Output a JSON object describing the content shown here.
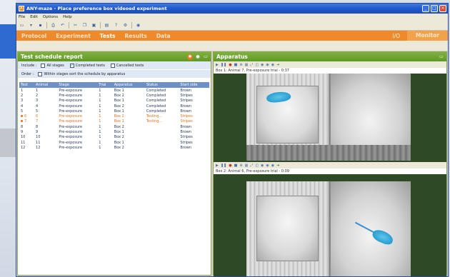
{
  "window": {
    "title": "ANY-maze - Place preference box videoed experiment",
    "app_icon_letter": "A"
  },
  "menu": [
    "File",
    "Edit",
    "Options",
    "Help"
  ],
  "nav": {
    "items": [
      {
        "label": "Protocol",
        "active": false
      },
      {
        "label": "Experiment",
        "active": false
      },
      {
        "label": "Tests",
        "active": true
      },
      {
        "label": "Results",
        "active": false
      },
      {
        "label": "Data",
        "active": false
      }
    ],
    "io_label": "I/O",
    "monitor_label": "Monitor"
  },
  "schedule_panel": {
    "title": "Test schedule report",
    "include_label": "Include :",
    "include_options": [
      {
        "label": "All stages",
        "checked": false
      },
      {
        "label": "Completed tests",
        "checked": true
      },
      {
        "label": "Cancelled tests",
        "checked": false
      }
    ],
    "order_label": "Order :",
    "order_option": {
      "label": "Within stages sort the schedule by apparatus",
      "checked": false
    },
    "columns": [
      "Test",
      "Animal",
      "Stage",
      "Trial",
      "Apparatus",
      "Status",
      "Start side"
    ],
    "rows": [
      {
        "test": "1",
        "animal": "1",
        "stage": "Pre-exposure",
        "trial": "1",
        "apparatus": "Box 1",
        "status": "Completed",
        "start_side": "Brown",
        "running": false
      },
      {
        "test": "2",
        "animal": "2",
        "stage": "Pre-exposure",
        "trial": "1",
        "apparatus": "Box 2",
        "status": "Completed",
        "start_side": "Stripes",
        "running": false
      },
      {
        "test": "3",
        "animal": "3",
        "stage": "Pre-exposure",
        "trial": "1",
        "apparatus": "Box 1",
        "status": "Completed",
        "start_side": "Stripes",
        "running": false
      },
      {
        "test": "4",
        "animal": "4",
        "stage": "Pre-exposure",
        "trial": "1",
        "apparatus": "Box 2",
        "status": "Completed",
        "start_side": "Brown",
        "running": false
      },
      {
        "test": "5",
        "animal": "5",
        "stage": "Pre-exposure",
        "trial": "1",
        "apparatus": "Box 1",
        "status": "Completed",
        "start_side": "Brown",
        "running": false
      },
      {
        "test": "6",
        "animal": "6",
        "stage": "Pre-exposure",
        "trial": "1",
        "apparatus": "Box 2",
        "status": "Testing...",
        "start_side": "Stripes",
        "running": true
      },
      {
        "test": "7",
        "animal": "7",
        "stage": "Pre-exposure",
        "trial": "1",
        "apparatus": "Box 1",
        "status": "Testing...",
        "start_side": "Stripes",
        "running": true
      },
      {
        "test": "8",
        "animal": "8",
        "stage": "Pre-exposure",
        "trial": "1",
        "apparatus": "Box 2",
        "status": "",
        "start_side": "Brown",
        "running": false
      },
      {
        "test": "9",
        "animal": "9",
        "stage": "Pre-exposure",
        "trial": "1",
        "apparatus": "Box 1",
        "status": "",
        "start_side": "Brown",
        "running": false
      },
      {
        "test": "10",
        "animal": "10",
        "stage": "Pre-exposure",
        "trial": "1",
        "apparatus": "Box 2",
        "status": "",
        "start_side": "Stripes",
        "running": false
      },
      {
        "test": "11",
        "animal": "11",
        "stage": "Pre-exposure",
        "trial": "1",
        "apparatus": "Box 1",
        "status": "",
        "start_side": "Stripes",
        "running": false
      },
      {
        "test": "12",
        "animal": "12",
        "stage": "Pre-exposure",
        "trial": "1",
        "apparatus": "Box 2",
        "status": "",
        "start_side": "Brown",
        "running": false
      }
    ]
  },
  "apparatus_panel": {
    "title": "Apparatus",
    "box1_caption": "Box 1: Animal 7, Pre-exposure trial - 0:37",
    "box2_caption": "Box 2: Animal 6, Pre-exposure trial - 0:09"
  },
  "colors": {
    "nav_orange": "#f0892a",
    "panel_green": "#6fa532",
    "titlebar_blue": "#2258c9",
    "running_orange": "#e07020",
    "tracking_blue": "#2a9fd2"
  }
}
